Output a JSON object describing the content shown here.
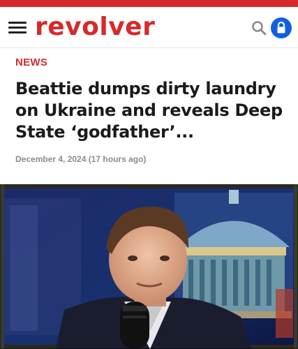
{
  "header": {
    "logo_text": "revolver",
    "menu_icon": "hamburger-menu-icon",
    "search_icon": "search-icon",
    "lock_icon": "lock-icon",
    "accent_color": "#d62a2a",
    "lock_button_color": "#1060e0"
  },
  "article": {
    "category": "NEWS",
    "headline": "Beattie dumps dirty laundry on Ukraine and reveals Deep State ‘godfather’...",
    "date": "December 4, 2024",
    "relative_time": "(17 hours ago)"
  }
}
